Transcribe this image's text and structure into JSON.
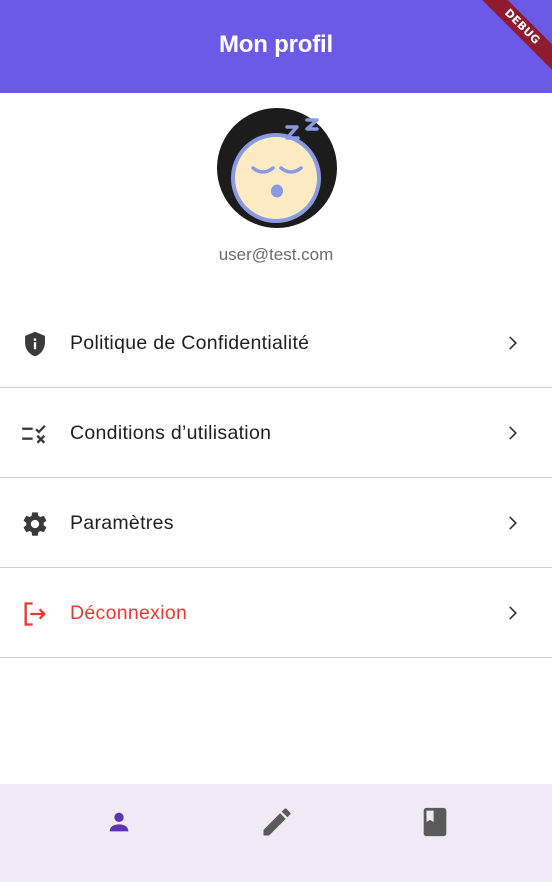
{
  "appbar": {
    "title": "Mon profil",
    "debug_banner": "DEBUG"
  },
  "profile": {
    "email": "user@test.com",
    "avatar_icon": "sleeping-face-icon"
  },
  "menu": {
    "items": [
      {
        "label": "Politique de Confidentialité",
        "icon": "shield-info-icon"
      },
      {
        "label": "Conditions d’utilisation",
        "icon": "rule-check-icon"
      },
      {
        "label": "Paramètres",
        "icon": "gear-icon"
      },
      {
        "label": "Déconnexion",
        "icon": "logout-icon",
        "color": "#E53935"
      }
    ]
  },
  "bottom_nav": {
    "items": [
      {
        "icon": "person-icon",
        "active": true
      },
      {
        "icon": "pencil-icon",
        "active": false
      },
      {
        "icon": "book-icon",
        "active": false
      }
    ]
  },
  "colors": {
    "primary": "#6A5AE6",
    "active_nav": "#5E35B1",
    "danger": "#E53935",
    "nav_bg": "#F1EAF6"
  }
}
